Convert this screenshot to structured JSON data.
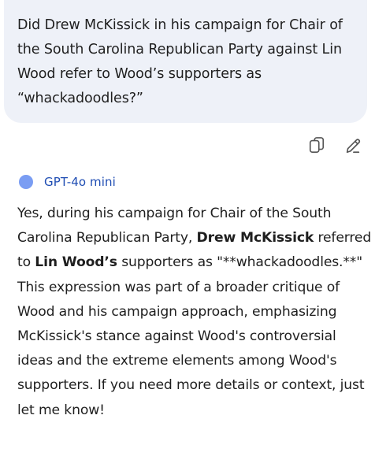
{
  "user_message": {
    "text": "Did Drew McKissick in his campaign for Chair of the South Carolina Republican Party against Lin Wood refer to Wood’s supporters as “whackadoodles?”"
  },
  "actions": {
    "copy_icon": "copy-icon",
    "edit_icon": "pencil-icon"
  },
  "model": {
    "name": "GPT-4o mini",
    "dot_color": "#7a9df3"
  },
  "reply": {
    "part1": "Yes, during his campaign for Chair of the South Carolina Republican Party, ",
    "bold1": "Drew McKissick",
    "part2": " referred to ",
    "bold2": "Lin Wood’s",
    "part3": " supporters as \"**whackadoodles.**\" This expression was part of a broader critique of Wood and his campaign approach, emphasizing McKissick's stance against Wood's controversial ideas and the extreme elements among Wood's supporters. If you need more details or context, just let me know!"
  }
}
